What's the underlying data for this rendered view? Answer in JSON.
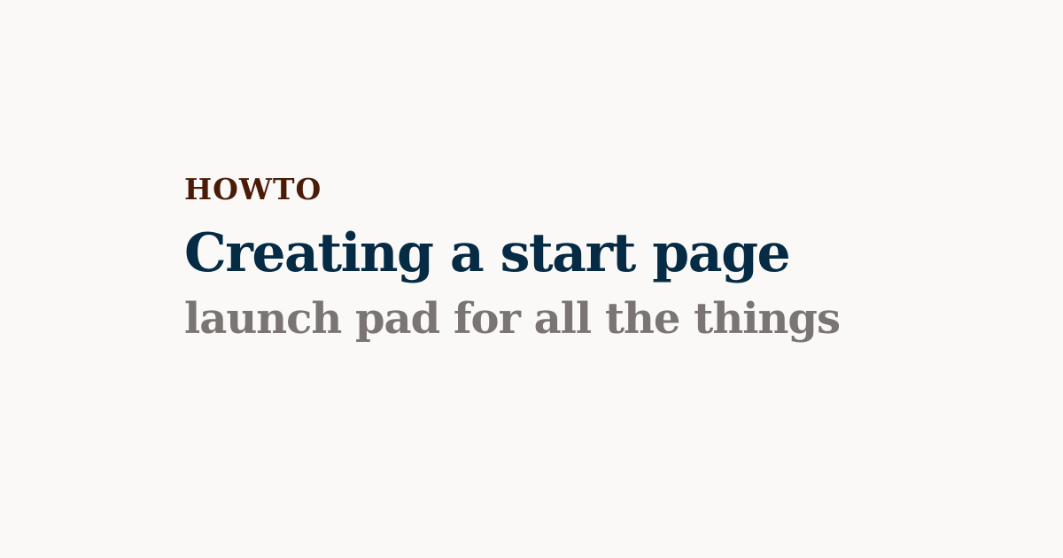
{
  "card": {
    "kicker": "HOWTO",
    "title": "Creating a start page",
    "subtitle": "launch pad for all the things"
  },
  "colors": {
    "background": "#faf9f7",
    "kicker": "#4a1c08",
    "title": "#062b45",
    "subtitle": "#7a7573"
  }
}
